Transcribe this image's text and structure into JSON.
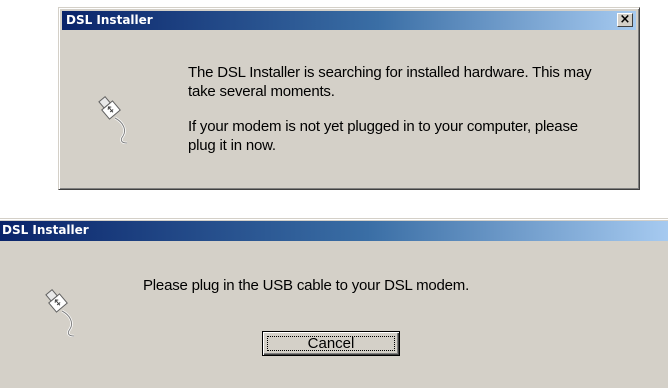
{
  "dialog_top": {
    "title": "DSL Installer",
    "close_glyph": "×",
    "icon": "usb-cable-icon",
    "message_1": "The DSL Installer is searching for installed hardware.  This may take several moments.",
    "message_2": "If your modem is not yet plugged in to your computer, please plug it in now."
  },
  "dialog_bottom": {
    "title": "DSL Installer",
    "icon": "usb-cable-icon",
    "message": "Please plug in the USB cable to your DSL modem.",
    "cancel_label": "Cancel"
  },
  "colors": {
    "dialog_face": "#d4d0c8",
    "titlebar_start": "#0a246a",
    "titlebar_end": "#a6caf0",
    "title_text": "#ffffff"
  }
}
